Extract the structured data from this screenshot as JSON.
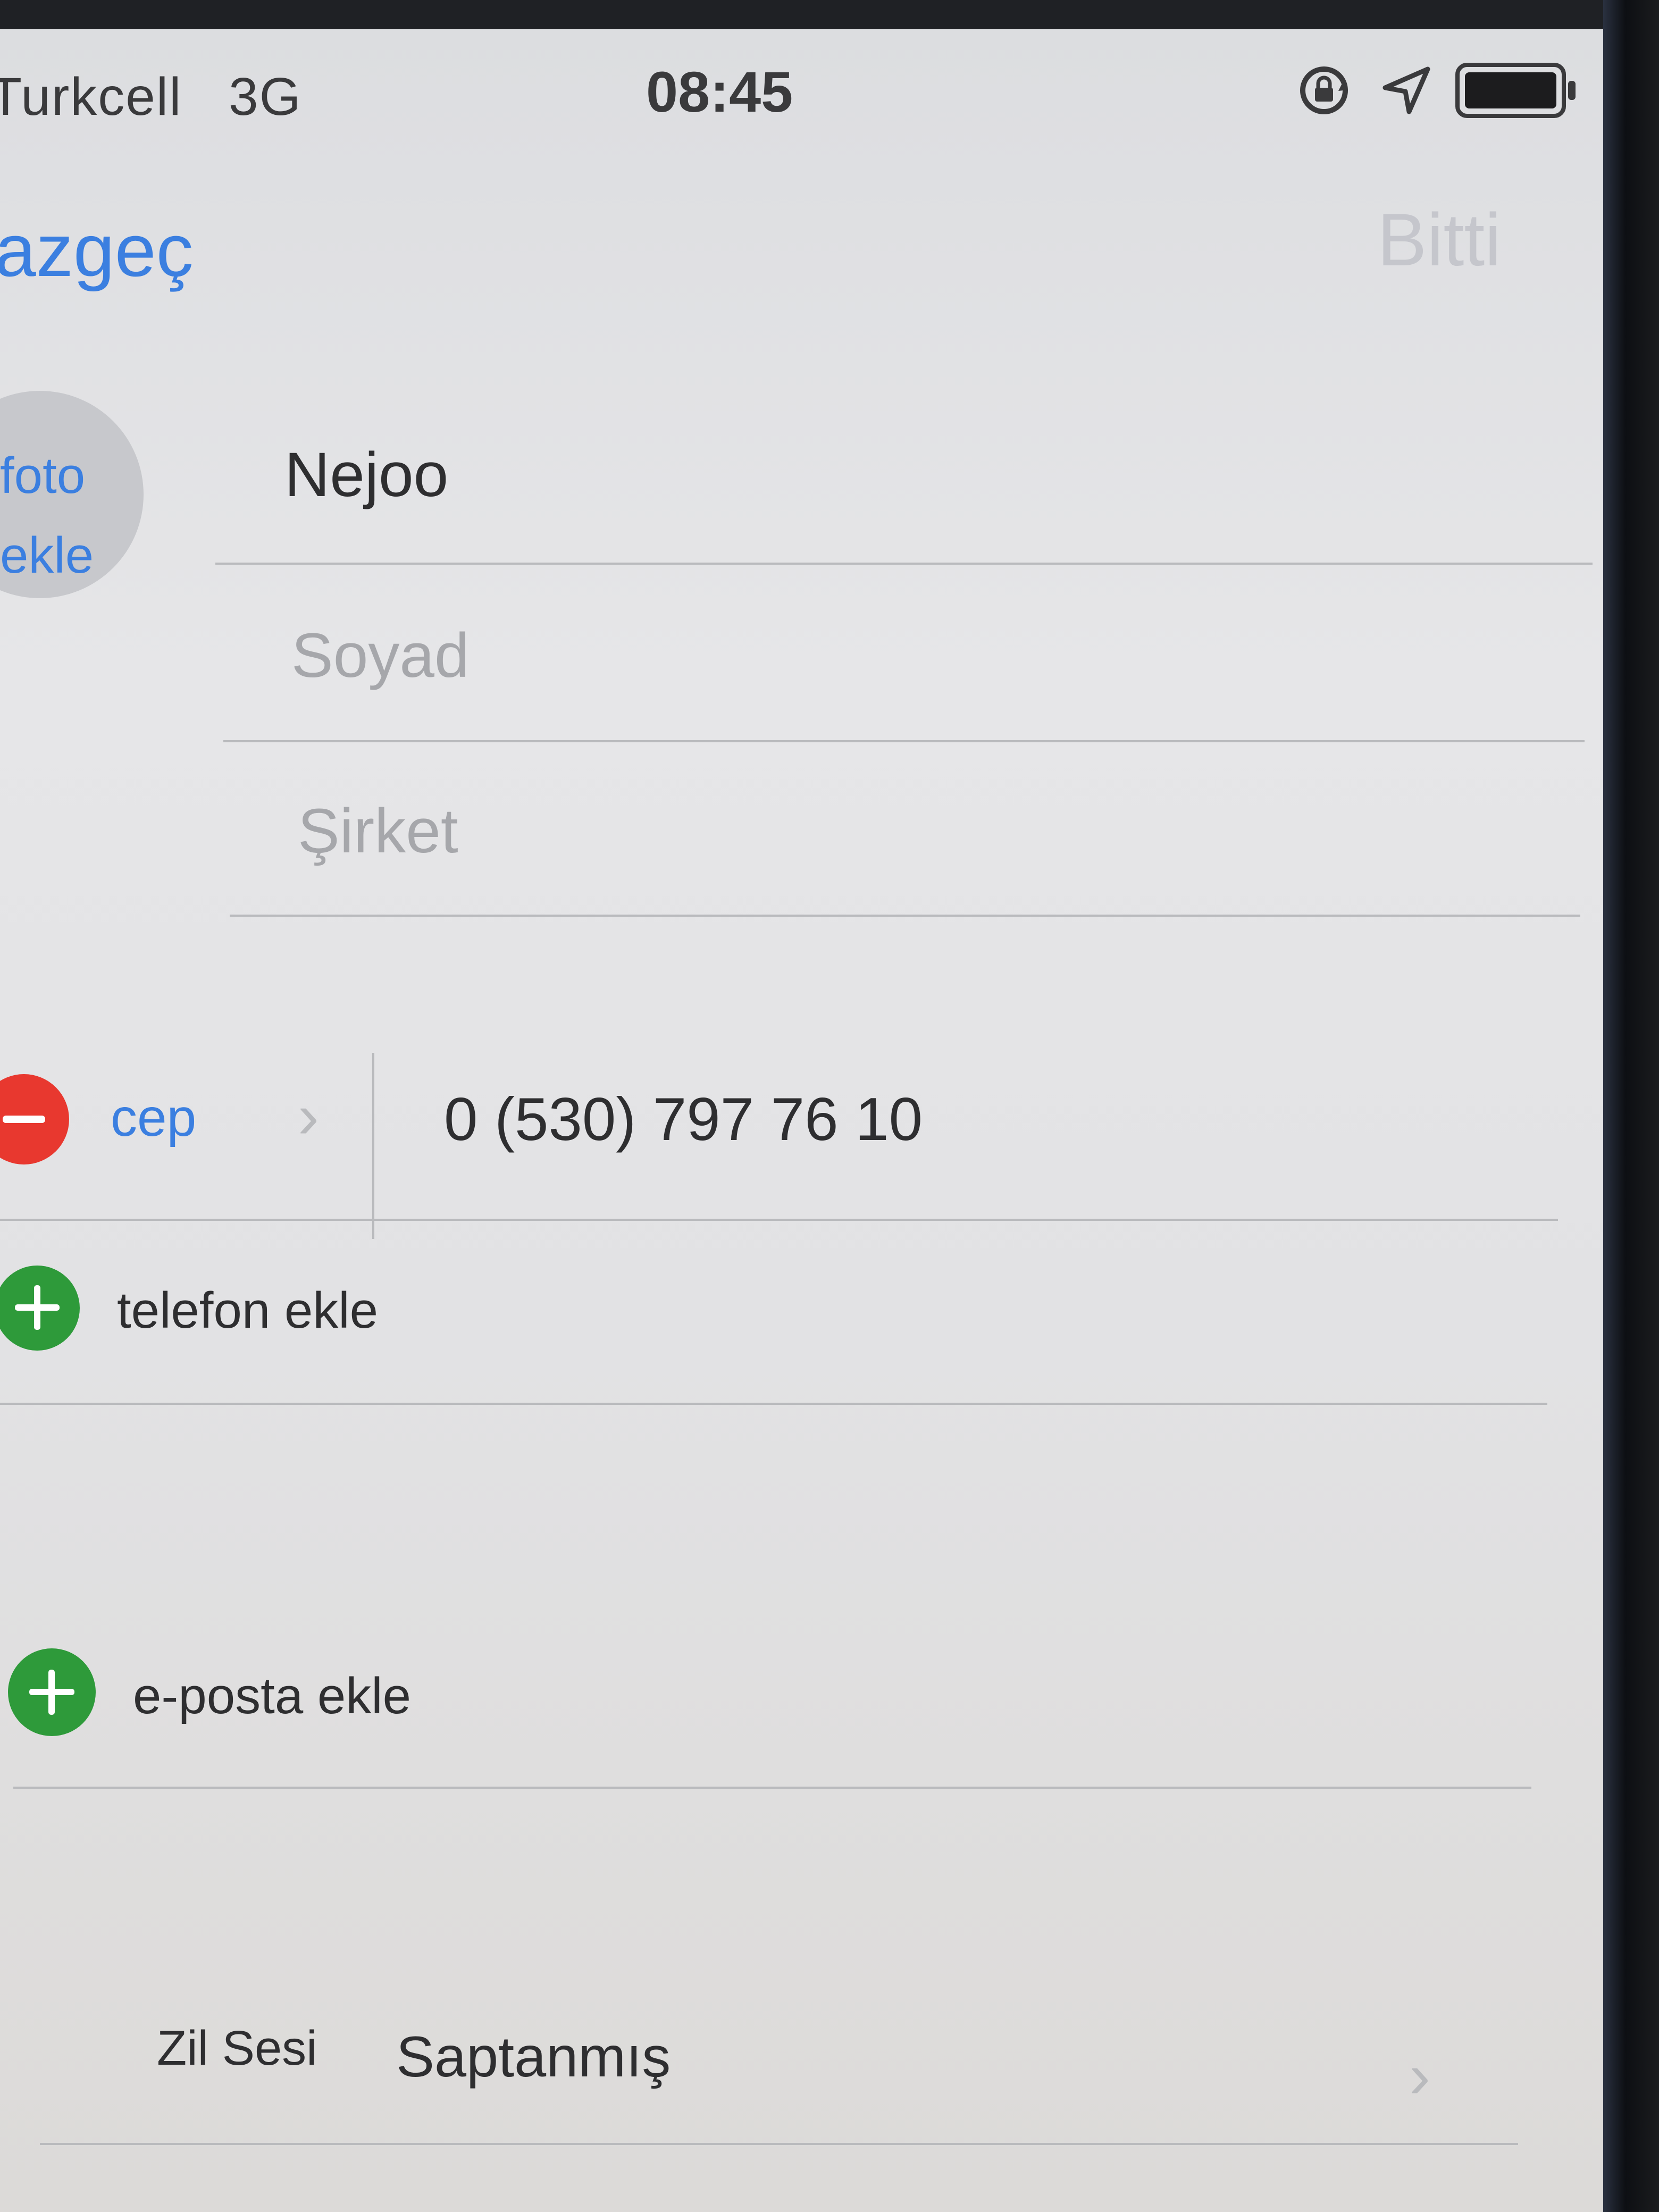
{
  "status_bar": {
    "carrier": "Turkcell",
    "network": "3G",
    "time": "08:45",
    "icons": [
      "rotation-lock-icon",
      "location-icon",
      "battery-icon"
    ]
  },
  "nav": {
    "cancel_label": "azgeç",
    "done_label": "Bitti"
  },
  "avatar": {
    "line1": "foto",
    "line2": "ekle"
  },
  "fields": {
    "first_name_value": "Nejoo",
    "last_name_placeholder": "Soyad",
    "company_placeholder": "Şirket"
  },
  "phone": {
    "label": "cep",
    "number": "0 (530) 797 76 10",
    "add_label": "telefon ekle"
  },
  "email": {
    "add_label": "e-posta ekle"
  },
  "ringtone": {
    "label": "Zil Sesi",
    "value": "Saptanmış"
  },
  "colors": {
    "accent": "#3b7fe0",
    "delete": "#e8382f",
    "add": "#2e9a3a"
  }
}
